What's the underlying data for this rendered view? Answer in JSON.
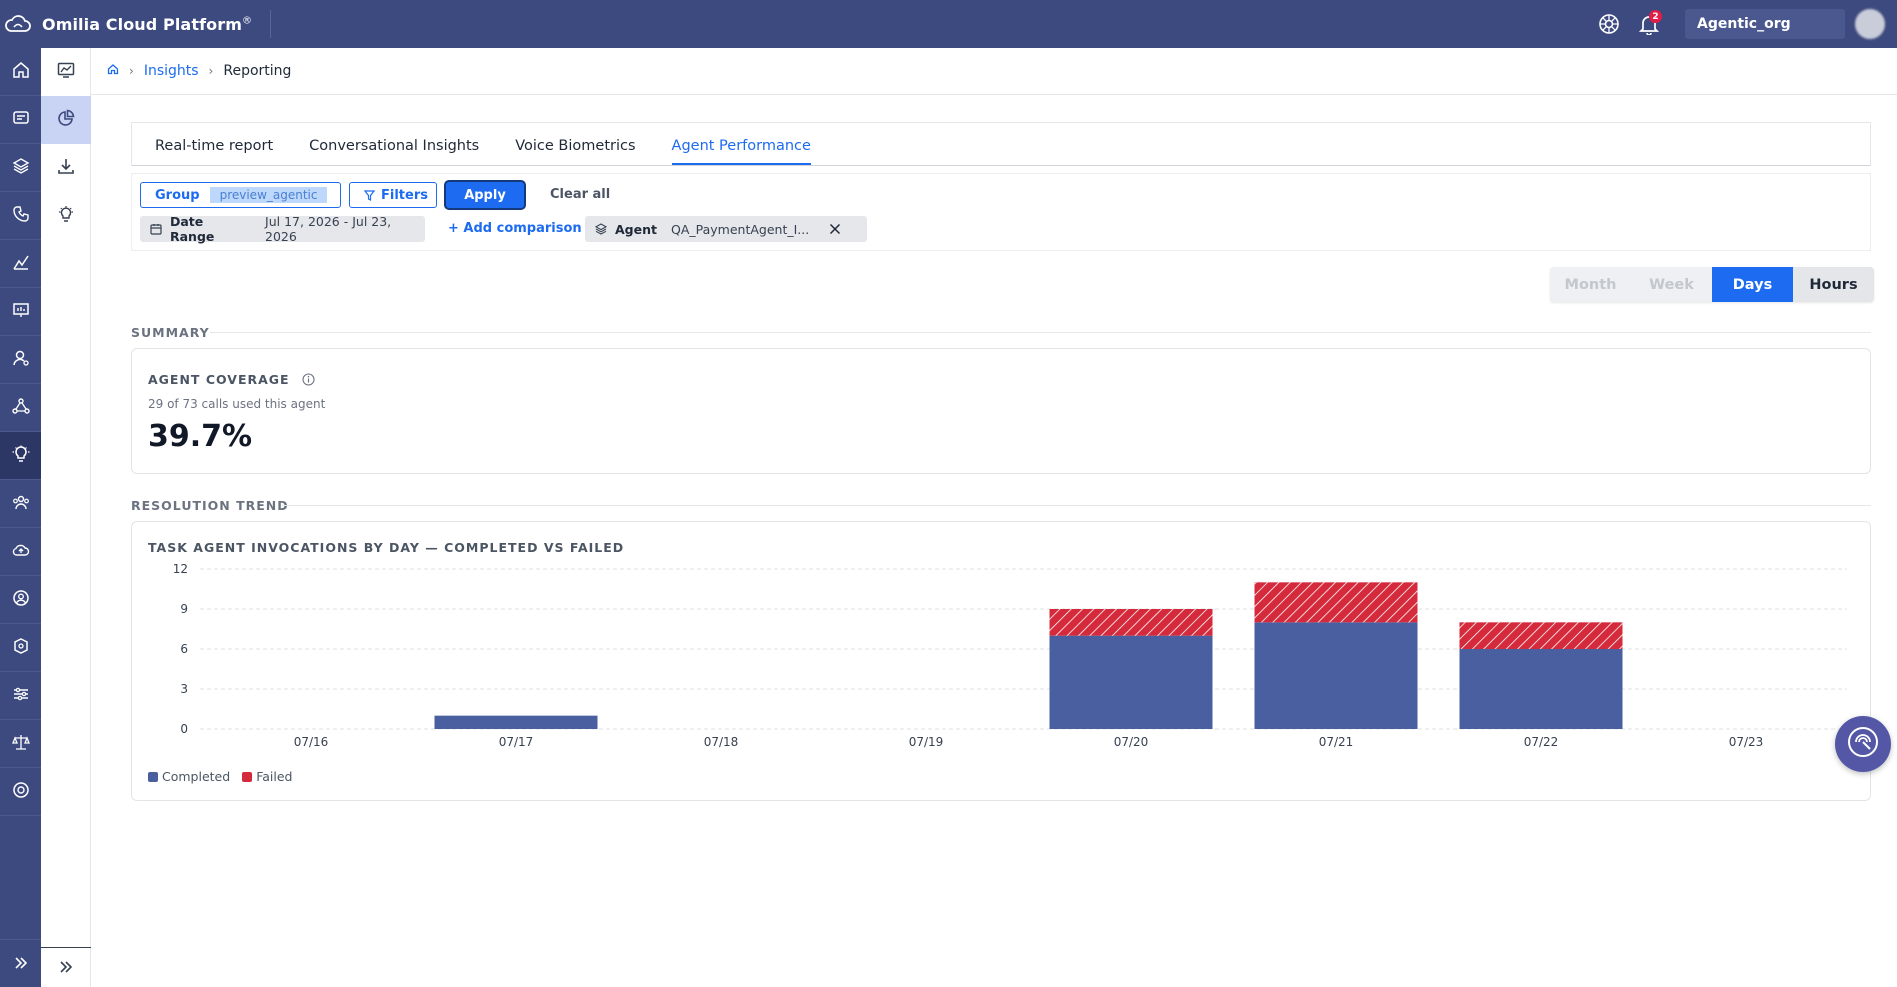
{
  "header": {
    "app_title": "Omilia Cloud Platform",
    "app_title_mark": "®",
    "notification_count": "2",
    "org_name": "Agentic_org",
    "icons": [
      "cloud-logo-icon",
      "help-wheel-icon",
      "bell-icon",
      "avatar"
    ]
  },
  "rail": {
    "icons": [
      "home-icon",
      "dialog-icon",
      "layers-icon",
      "phone-icon",
      "analytics-icon",
      "presentation-icon",
      "user-settings-icon",
      "network-icon",
      "insights-bulb-icon",
      "team-icon",
      "cloud-upload-icon",
      "user-circle-icon",
      "security-icon",
      "settings-sliders-icon",
      "scale-icon",
      "support-icon"
    ],
    "active_index": 8,
    "expand_icon": "double-chevron-right-icon"
  },
  "subnav": {
    "icons": [
      "monitor-chart-icon",
      "pie-chart-icon",
      "download-icon",
      "lightbulb-icon"
    ],
    "active_index": 1,
    "collapse_icon": "double-chevron-right-icon"
  },
  "breadcrumb": {
    "home_icon": "home-icon",
    "items": [
      "Insights",
      "Reporting"
    ]
  },
  "tabs": [
    "Real-time report",
    "Conversational Insights",
    "Voice Biometrics",
    "Agent Performance"
  ],
  "active_tab": 3,
  "filters": {
    "group_label": "Group",
    "group_value": "preview_agentic",
    "filters_label": "Filters",
    "apply_label": "Apply",
    "clear_label": "Clear all",
    "date_range_label": "Date Range",
    "date_range_value": "Jul 17, 2026 - Jul 23, 2026",
    "add_comparison_label": "+ Add comparison",
    "agent_label": "Agent",
    "agent_value": "QA_PaymentAgent_I..."
  },
  "granularity": {
    "options": [
      "Month",
      "Week",
      "Days",
      "Hours"
    ],
    "selected": "Days"
  },
  "summary": {
    "section_title": "SUMMARY",
    "card_title": "AGENT COVERAGE",
    "subtitle": "29 of 73 calls used this agent",
    "value": "39.7%"
  },
  "trend": {
    "section_title": "RESOLUTION TREND",
    "card_title": "TASK AGENT INVOCATIONS BY DAY — COMPLETED VS FAILED"
  },
  "colors": {
    "completed": "#4a5fa0",
    "failed": "#d42a3c",
    "accent": "#1d6bf0",
    "nav": "#3d4a7f"
  },
  "chart_data": {
    "type": "bar",
    "stacked": true,
    "title": "TASK AGENT INVOCATIONS BY DAY — COMPLETED VS FAILED",
    "categories": [
      "07/16",
      "07/17",
      "07/18",
      "07/19",
      "07/20",
      "07/21",
      "07/22",
      "07/23"
    ],
    "series": [
      {
        "name": "Completed",
        "values": [
          0,
          1,
          0,
          0,
          7,
          8,
          6,
          0
        ],
        "color": "#4a5fa0"
      },
      {
        "name": "Failed",
        "values": [
          0,
          0,
          0,
          0,
          2,
          3,
          2,
          0
        ],
        "color": "#d42a3c",
        "pattern": "hatched"
      }
    ],
    "yticks": [
      0,
      3,
      6,
      9,
      12
    ],
    "ylim": [
      0,
      12
    ],
    "grid": true,
    "legend": "bottom-left"
  }
}
